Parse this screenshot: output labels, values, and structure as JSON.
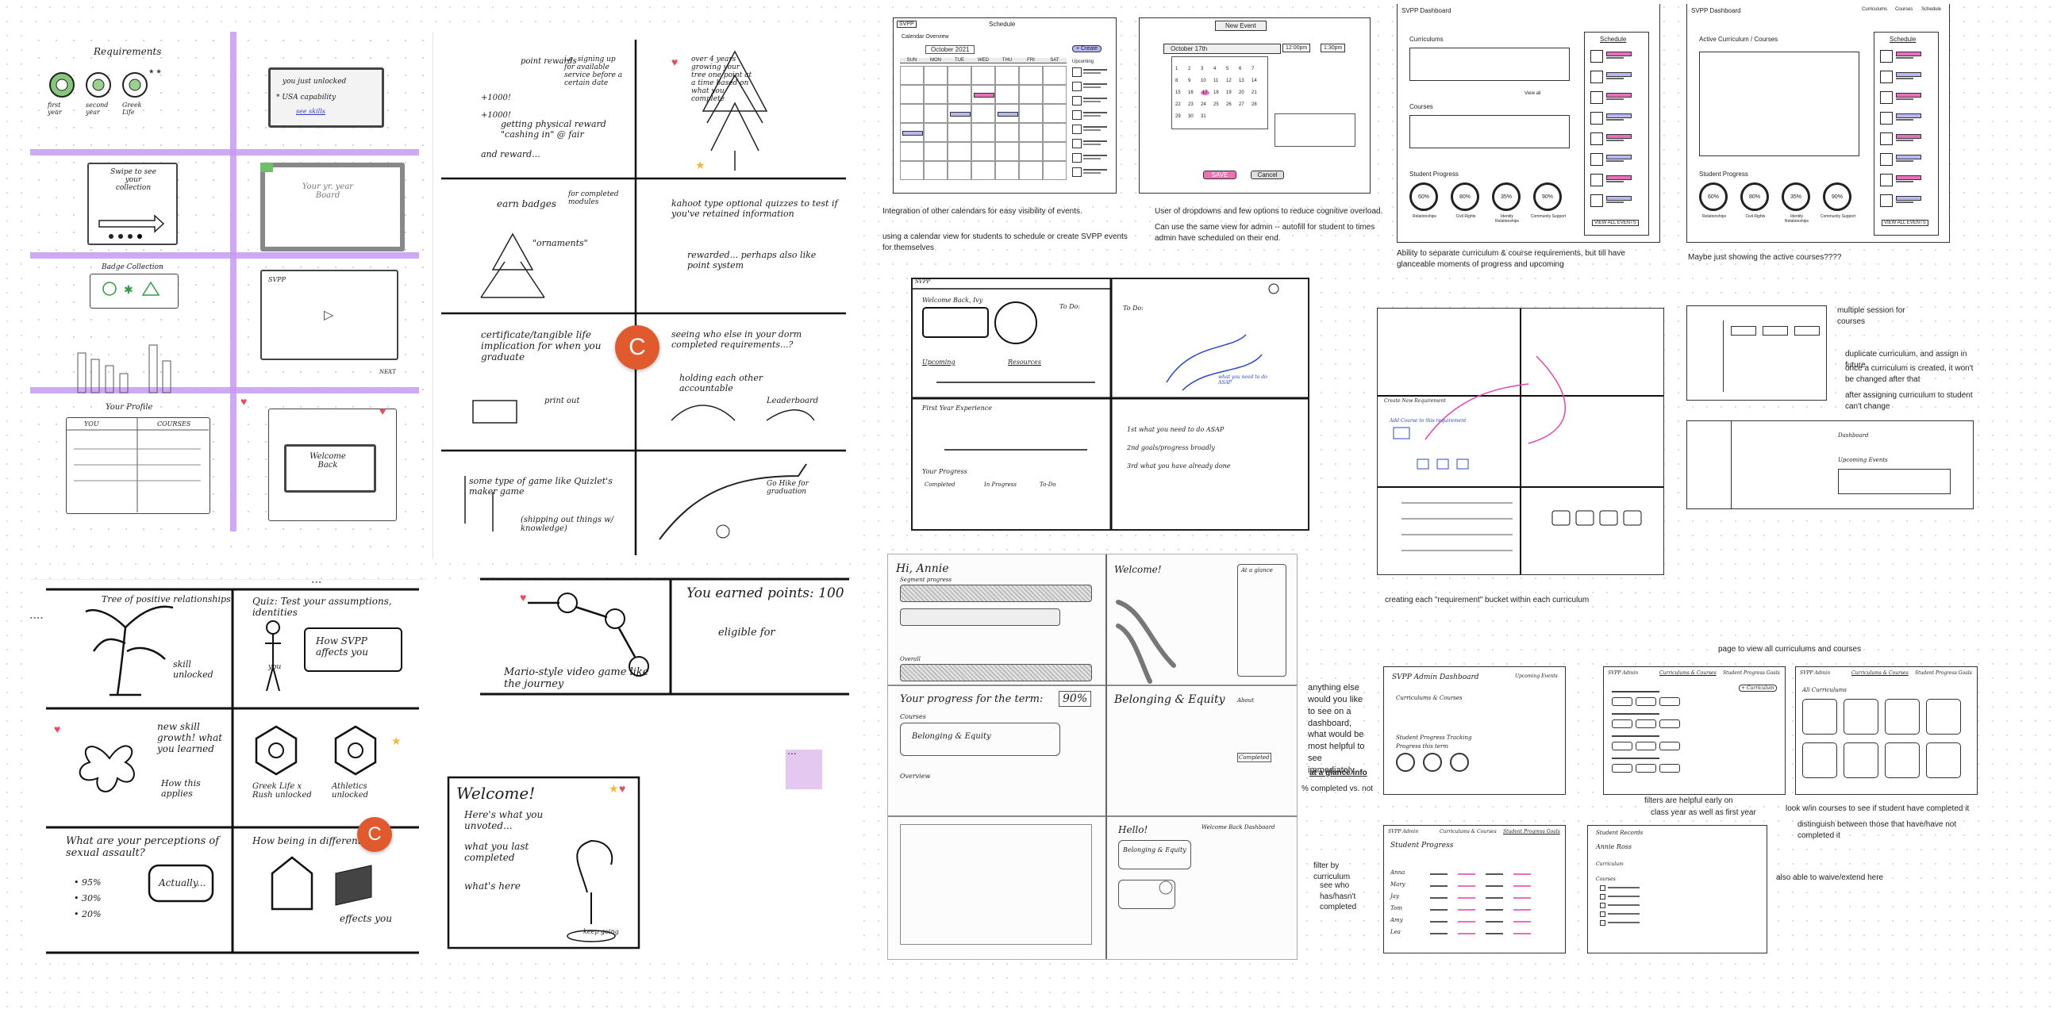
{
  "canvas": {
    "accent_purple": "#c69bf3",
    "avatar_color": "#e15a2e",
    "note_pink": "#f06fb0"
  },
  "avatars": {
    "user_initial": "C"
  },
  "board1": {
    "requirements_title": "Requirements",
    "first_year": "first year",
    "second_year": "second year",
    "greek_life": "Greek Life",
    "unlocked_title": "you just unlocked",
    "unlocked_item": "* USA capability",
    "see_skills": "see skills",
    "swipe": "Swipe to see your collection",
    "board_label": "Your yr. year Board",
    "badge_collection": "Badge Collection",
    "svpp": "SVPP",
    "next": "NEXT",
    "your_profile": "Your Profile",
    "col_you": "YOU",
    "col_courses": "COURSES",
    "welcome_back": "Welcome Back"
  },
  "board2": {
    "points_rewards": "point rewards",
    "ie_text": "i.e. signing up for available service before a certain date",
    "getting_reward": "getting physical reward \"cashing in\" @ fair",
    "points1": "+1000!",
    "points2": "+1000!",
    "and_reward": "and reward...",
    "grow_tree": "over 4 years growing your tree one point at a time based on what you complete",
    "earn_badges": "earn badges",
    "for_completed": "for completed modules",
    "ornaments": "\"ornaments\"",
    "kahoot": "kahoot type optional quizzes to test if you've retained information",
    "rewarded": "rewarded... perhaps also like point system",
    "certificate": "certificate/tangible life implication for when you graduate",
    "print_out": "print out",
    "seeing_who": "seeing who else in your dorm completed requirements...?",
    "holding": "holding each other accountable",
    "leaderboard": "Leaderboard",
    "game_type": "some type of game like Quizlet's maker game",
    "shipping": "(shipping out things w/ knowledge)",
    "go_hike": "Go Hike for graduation"
  },
  "board3": {
    "tree_title": "Tree of positive relationships",
    "skill_unlocked": "skill unlocked",
    "quiz": "Quiz: Test your assumptions, identities",
    "you": "you",
    "how_svpp": "How SVPP affects you",
    "new_skill": "new skill growth! what you learned",
    "how_this": "How this applies",
    "greek_unlocked": "Greek Life x Rush unlocked",
    "athletics": "Athletics unlocked",
    "perception": "What are your perceptions of sexual assault?",
    "p1": "• 95%",
    "p2": "• 30%",
    "p3": "• 20%",
    "actually": "Actually...",
    "how_being": "How being in different",
    "effects": "effects you"
  },
  "board4": {
    "mario": "Mario-style video game like the journey",
    "you_earned": "You earned points: 100",
    "eligible": "eligible for",
    "welcome": "Welcome!",
    "heres": "Here's what you unvoted...",
    "what_you": "what you last completed",
    "whats_here": "what's here",
    "keep_going": "keep going"
  },
  "sched": {
    "svpp": "SVPP",
    "schedule": "Schedule",
    "cal_overview": "Calendar Overview",
    "month": "October 2021",
    "create": "+ Create",
    "upcoming": "Upcoming",
    "days": [
      "SUN",
      "MON",
      "TUE",
      "WED",
      "THU",
      "FRI",
      "SAT"
    ],
    "new_event": "New Event",
    "date_field": "October 17th",
    "time_from": "12:00pm",
    "time_to": "1:30pm",
    "save": "SAVE",
    "cancel": "Cancel",
    "note1": "Integration of other calendars for easy visibility of events.",
    "note2": "using a calendar view for students to schedule or create SVPP events for themselves",
    "note3": "User of dropdowns and few options to reduce cognitive overload.",
    "note4": "Can use the same view for admin -- autofill for student to times admin have scheduled on their end."
  },
  "dashboard": {
    "svpp_dashboard": "SVPP Dashboard",
    "curriculums": "Curriculums",
    "courses": "Courses",
    "student_progress": "Student Progress",
    "schedule": "Schedule",
    "view_all_events": "VIEW ALL EVENTS",
    "view_all": "View all",
    "rings": [
      "60%",
      "80%",
      "35%",
      "90%"
    ],
    "ring_labels": [
      "Relationships",
      "Civil Rights",
      "Identity Relationships",
      "Community Support"
    ],
    "note": "Ability to separate curriculum & course requirements, but till have glanceable moments of progress and upcoming",
    "dash2_links": [
      "Curriculums",
      "Courses",
      "Schedule"
    ],
    "active": "Active Curriculum / Courses",
    "note2": "Maybe just showing the active courses????"
  },
  "sketch_mid": {
    "svpp": "SVPP",
    "welcome_back": "Welcome Back, Ivy",
    "to_do": "To Do:",
    "upcoming": "Upcoming",
    "resources": "Resources",
    "first_year": "First Year Experience",
    "your_progress": "Your Progress",
    "completed": "Completed",
    "in_progress": "In Progress",
    "to_do2": "To-Do",
    "step1": "1st  what you need to do ASAP",
    "step2": "2nd  goals/progress broadly",
    "step3": "3rd  what you have already done",
    "handwritten": "what you need to do ASAP"
  },
  "requirements": {
    "note": "creating each \"requirement\" bucket within each curriculum",
    "multiple": "multiple session for courses",
    "duplicate": "duplicate curriculum, and assign in future",
    "once": "once a curriculum is created, it won't be changed after that",
    "after": "after assigning curriculum to student can't change",
    "label_dashboard": "Dashboard",
    "label_upcoming": "Upcoming Events",
    "label_requirement": "Create New Requirement",
    "label_add_course": "Add Course to this requirement"
  },
  "pencil": {
    "hi": "Hi, Annie",
    "segment": "Segment progress",
    "overall": "Overall",
    "welcome": "Welcome!",
    "progress": "Your progress for the term:",
    "percent": "90%",
    "belonging": "Belonging & Equity",
    "courses": "Courses",
    "overview": "Overview",
    "hello": "Hello!",
    "welcome_dash": "Welcome Back Dashboard",
    "completed": "Completed",
    "about": "About",
    "at_glance": "At a glance"
  },
  "admin": {
    "ask": "anything else would you like to see on a dashboard, what would be most helpful to see immediately",
    "glance": "at a glance info",
    "pct": "% completed vs. not",
    "filter": "filter by curriculum",
    "filter_b1": "see who has/hasn't completed",
    "page_view": "page to view all curriculums and courses",
    "filters_help": "filters are helpful early on",
    "filters_b1": "class year as well as first year",
    "look": "look w/in courses to see if student have completed it",
    "distinguish": "distinguish between those that have/have not completed it",
    "waive": "also able to waive/extend here",
    "svpp_admin": "SVPP Admin Dashboard",
    "curr_courses": "Curriculums & Courses",
    "student_prog": "Student Progress Tracking",
    "progress_term": "Progress this term",
    "upcoming": "Upcoming Events",
    "nav": [
      "SVPP Admin",
      "Curriculums & Courses",
      "Student Progress Goals"
    ],
    "add_curr": "+ Curriculum",
    "all_curr": "All Curriculums",
    "student_progress": "Student Progress",
    "student_names": [
      "Anna",
      "Mary",
      "Jay",
      "Tom",
      "Amy",
      "Lea"
    ],
    "student_records": "Student Records",
    "annie": "Annie Ross",
    "curriculum": "Curriculum",
    "courses_lbl": "Courses"
  }
}
